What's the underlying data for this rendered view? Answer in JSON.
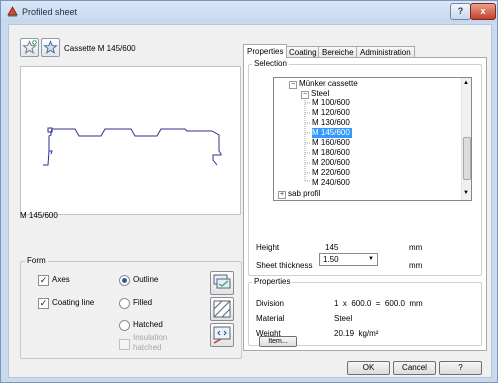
{
  "window": {
    "title": "Profiled sheet",
    "help_glyph": "?",
    "close_glyph": "x"
  },
  "header": {
    "profile_name": "Cassette M 145/600"
  },
  "left": {
    "profile_caption": "M 145/600",
    "form": {
      "title": "Form",
      "axes": {
        "label": "Axes",
        "checked": true
      },
      "coating_line": {
        "label": "Coating line",
        "checked": true
      },
      "outline": "Outline",
      "filled": "Filled",
      "hatched": "Hatched",
      "insulation_hatched": [
        "Insulation",
        "hatched"
      ]
    }
  },
  "tabs": [
    "Properties",
    "Coating",
    "Bereiche",
    "Administration"
  ],
  "selection": {
    "title": "Selection",
    "tree": {
      "root": "Münker cassette",
      "group": "Steel",
      "items": [
        "M 100/600",
        "M 120/600",
        "M 130/600",
        "M 145/600",
        "M 160/600",
        "M 180/600",
        "M 200/600",
        "M 220/600",
        "M 240/600"
      ],
      "selected_index": 3,
      "last": "sab profil"
    },
    "height_label": "Height",
    "height_value": "145",
    "height_unit": "mm",
    "thickness_label": "Sheet thickness",
    "thickness_value": "1.50",
    "thickness_unit": "mm"
  },
  "properties": {
    "title": "Properties",
    "division_label": "Division",
    "division_value": "1  x  600.0  =  600.0  mm",
    "material_label": "Material",
    "material_value": "Steel",
    "weight_label": "Weight",
    "weight_value": "20.19  kg/m²",
    "item_button": "Item..."
  },
  "footer": {
    "ok": "OK",
    "cancel": "Cancel",
    "help": "?"
  },
  "tree_glyphs": {
    "plus": "+",
    "minus": "−"
  },
  "colors": {
    "profile_line": "#2c2f8f",
    "selection": "#3399ff",
    "accent_red": "#c3402c"
  }
}
